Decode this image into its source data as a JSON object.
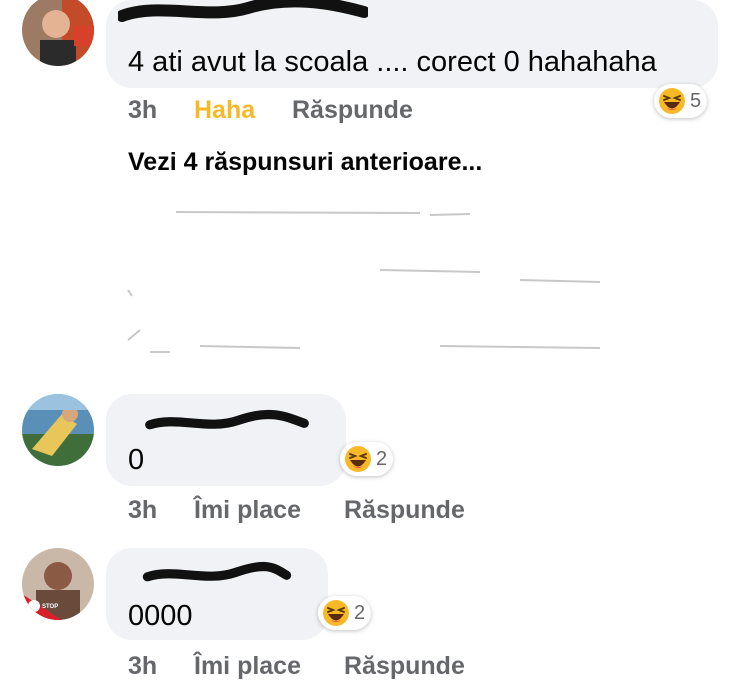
{
  "comments": [
    {
      "author": "",
      "text": "4 ati avut la scoala .... corect 0 hahahaha",
      "time": "3h",
      "reaction_label": "Haha",
      "reply_label": "Răspunde",
      "reaction_count": "5"
    },
    {
      "author": "",
      "text": "0",
      "time": "3h",
      "like_label": "Îmi place",
      "reply_label": "Răspunde",
      "reaction_count": "2"
    },
    {
      "author": "",
      "text": "0000",
      "time": "3h",
      "like_label": "Îmi place",
      "reply_label": "Răspunde",
      "reaction_count": "2",
      "avatar_badge": "STOP COVID-19"
    }
  ],
  "view_previous": "Vezi 4 răspunsuri anterioare...",
  "colors": {
    "bubble": "#f0f2f5",
    "secondary_text": "#65676b",
    "haha_active": "#f7b928",
    "emoji_yellow": "#f7b928"
  },
  "icons": [
    "haha-emoji-icon"
  ]
}
